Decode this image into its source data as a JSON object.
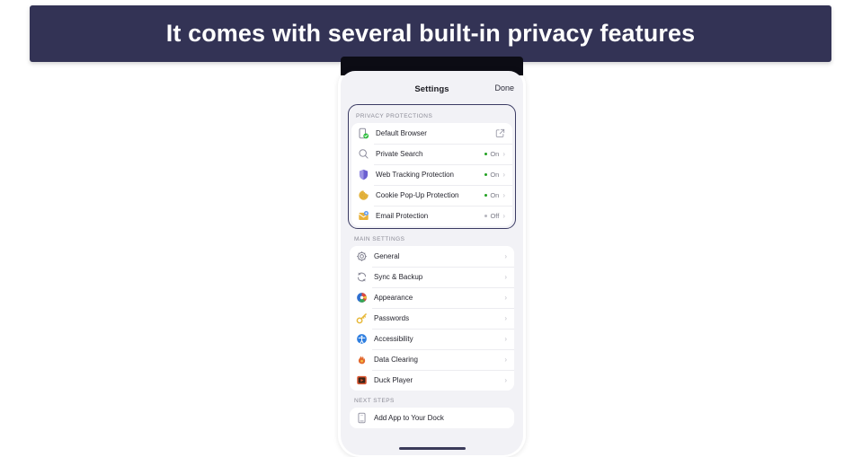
{
  "banner": {
    "title": "It comes with several built-in privacy features",
    "bg_color": "#333355",
    "text_color": "#ffffff"
  },
  "phone": {
    "navbar": {
      "title": "Settings",
      "done_label": "Done"
    },
    "sections": [
      {
        "label": "PRIVACY PROTECTIONS",
        "highlighted": true,
        "items": [
          {
            "label": "Default Browser",
            "icon": "default-browser-icon",
            "status": null,
            "accessory": "external-link-icon"
          },
          {
            "label": "Private Search",
            "icon": "search-icon",
            "status": "On",
            "status_state": "on",
            "accessory": "chevron-right-icon"
          },
          {
            "label": "Web Tracking Protection",
            "icon": "shield-icon",
            "status": "On",
            "status_state": "on",
            "accessory": "chevron-right-icon"
          },
          {
            "label": "Cookie Pop-Up Protection",
            "icon": "cookie-icon",
            "status": "On",
            "status_state": "on",
            "accessory": "chevron-right-icon"
          },
          {
            "label": "Email Protection",
            "icon": "email-icon",
            "status": "Off",
            "status_state": "off",
            "accessory": "chevron-right-icon"
          }
        ]
      },
      {
        "label": "MAIN SETTINGS",
        "highlighted": false,
        "items": [
          {
            "label": "General",
            "icon": "gear-icon",
            "status": null,
            "accessory": "chevron-right-icon"
          },
          {
            "label": "Sync & Backup",
            "icon": "sync-icon",
            "status": null,
            "accessory": "chevron-right-icon"
          },
          {
            "label": "Appearance",
            "icon": "appearance-icon",
            "status": null,
            "accessory": "chevron-right-icon"
          },
          {
            "label": "Passwords",
            "icon": "key-icon",
            "status": null,
            "accessory": "chevron-right-icon"
          },
          {
            "label": "Accessibility",
            "icon": "accessibility-icon",
            "status": null,
            "accessory": "chevron-right-icon"
          },
          {
            "label": "Data Clearing",
            "icon": "flame-icon",
            "status": null,
            "accessory": "chevron-right-icon"
          },
          {
            "label": "Duck Player",
            "icon": "duck-player-icon",
            "status": null,
            "accessory": "chevron-right-icon"
          }
        ]
      },
      {
        "label": "NEXT STEPS",
        "highlighted": false,
        "items": [
          {
            "label": "Add App to Your Dock",
            "icon": "dock-icon",
            "status": null,
            "accessory": null
          }
        ]
      }
    ],
    "colors": {
      "status_on": "#21a121",
      "status_off": "#b6b6bf",
      "highlight_border": "#3b3b63",
      "screen_bg": "#f2f2f6",
      "card_bg": "#ffffff"
    }
  }
}
